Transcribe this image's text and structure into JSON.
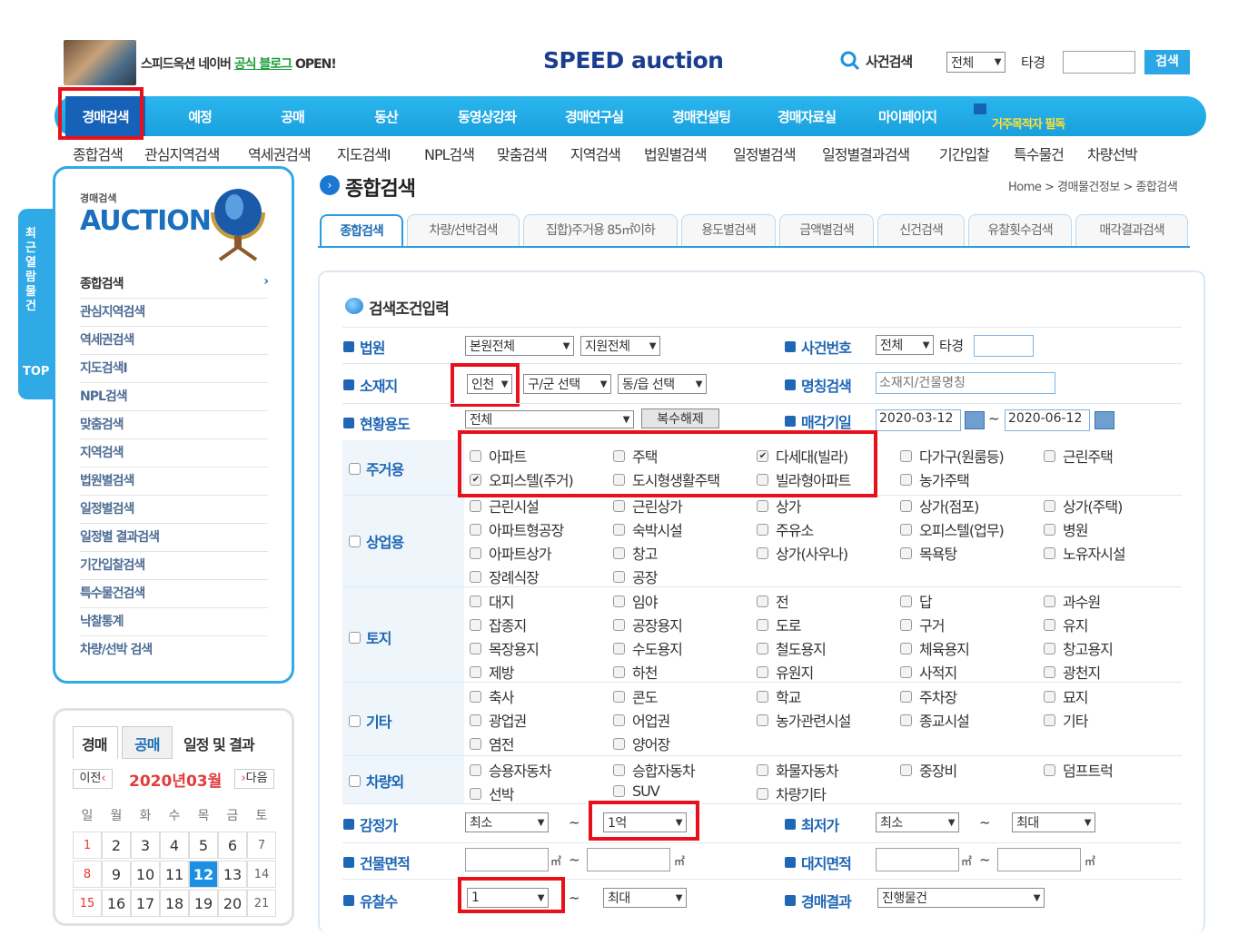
{
  "header": {
    "promo_prefix": "스피드옥션 네이버",
    "promo_highlight": "공식 블로그",
    "promo_suffix": "OPEN!",
    "brand_speed": "SPEED",
    "brand_auction": "auction",
    "case_search_label": "사건검색",
    "case_select": "전체",
    "case_word": "타경",
    "search_button": "검색"
  },
  "nav": [
    "경매검색",
    "예정",
    "공매",
    "동산",
    "동영상강좌",
    "경매연구실",
    "경매컨설팅",
    "경매자료실",
    "마이페이지"
  ],
  "nav_banner": "거주목적자 필독",
  "subnav": [
    "종합검색",
    "관심지역검색",
    "역세권검색",
    "지도검색Ⅰ",
    "NPL검색",
    "맞춤검색",
    "지역검색",
    "법원별검색",
    "일정별검색",
    "일정별결과검색",
    "기간입찰",
    "특수물건",
    "차량선박"
  ],
  "sidebar": {
    "tab_label": "최근열람물건",
    "top_label": "TOP",
    "small_title": "경매검색",
    "big_title": "AUCTION",
    "links": [
      "종합검색",
      "관심지역검색",
      "역세권검색",
      "지도검색Ⅰ",
      "NPL검색",
      "맞춤검색",
      "지역검색",
      "법원별검색",
      "일정별검색",
      "일정별 결과검색",
      "기간입찰검색",
      "특수물건검색",
      "낙찰통계",
      "차량/선박 검색"
    ]
  },
  "calendar": {
    "tabs": [
      "경매",
      "공매",
      "일정 및 결과"
    ],
    "prev": "이전",
    "month": "2020년03월",
    "next": "다음",
    "weekdays": [
      "일",
      "월",
      "화",
      "수",
      "목",
      "금",
      "토"
    ],
    "week1": [
      "1",
      "2",
      "3",
      "4",
      "5",
      "6",
      "7"
    ],
    "week2": [
      "8",
      "9",
      "10",
      "11",
      "12",
      "13",
      "14"
    ],
    "week3": [
      "15",
      "16",
      "17",
      "18",
      "19",
      "20",
      "21"
    ]
  },
  "main": {
    "title": "종합검색",
    "breadcrumb": "Home > 경매물건정보 > 종합검색",
    "tabs": [
      "종합검색",
      "차량/선박검색",
      "집합)주거용 85㎡이하",
      "용도별검색",
      "금액별검색",
      "신건검색",
      "유찰횟수검색",
      "매각결과검색"
    ],
    "panel_title": "검색조건입력"
  },
  "form": {
    "court_label": "법원",
    "court_value": "본원전체",
    "subcourt_value": "지원전체",
    "case_no_label": "사건번호",
    "case_no_select": "전체",
    "case_no_word": "타경",
    "location_label": "소재지",
    "location_city": "인천",
    "location_gu": "구/군 선택",
    "location_dong": "동/읍 선택",
    "name_search_label": "명칭검색",
    "name_search_placeholder": "소재지/건물명칭",
    "usage_label": "현황용도",
    "usage_value": "전체",
    "usage_reset": "복수해제",
    "sale_date_label": "매각기일",
    "sale_date_from": "2020-03-12",
    "sale_date_to": "2020-06-12",
    "tilde": "~",
    "residential_label": "주거용",
    "commercial_label": "상업용",
    "land_label": "토지",
    "etc_label": "기타",
    "vehicle_label": "차량외",
    "appraisal_label": "감정가",
    "appraisal_min": "최소",
    "appraisal_max": "1억",
    "lowest_label": "최저가",
    "lowest_min": "최소",
    "lowest_max": "최대",
    "building_area_label": "건물면적",
    "land_area_label": "대지면적",
    "unit": "㎡",
    "fail_count_label": "유찰수",
    "fail_min": "1",
    "fail_max": "최대",
    "result_label": "경매결과",
    "result_value": "진행물건"
  },
  "options": {
    "residential": [
      [
        "아파트",
        false
      ],
      [
        "주택",
        false
      ],
      [
        "다세대(빌라)",
        true
      ],
      [
        "다가구(원룸등)",
        false
      ],
      [
        "근린주택",
        false
      ],
      [
        "오피스텔(주거)",
        true
      ],
      [
        "도시형생활주택",
        false
      ],
      [
        "빌라형아파트",
        false
      ],
      [
        "농가주택",
        false
      ]
    ],
    "commercial": [
      [
        "근린시설",
        false
      ],
      [
        "근린상가",
        false
      ],
      [
        "상가",
        false
      ],
      [
        "상가(점포)",
        false
      ],
      [
        "상가(주택)",
        false
      ],
      [
        "아파트형공장",
        false
      ],
      [
        "숙박시설",
        false
      ],
      [
        "주유소",
        false
      ],
      [
        "오피스텔(업무)",
        false
      ],
      [
        "병원",
        false
      ],
      [
        "아파트상가",
        false
      ],
      [
        "창고",
        false
      ],
      [
        "상가(사우나)",
        false
      ],
      [
        "목욕탕",
        false
      ],
      [
        "노유자시설",
        false
      ],
      [
        "장례식장",
        false
      ],
      [
        "공장",
        false
      ]
    ],
    "land": [
      [
        "대지",
        false
      ],
      [
        "임야",
        false
      ],
      [
        "전",
        false
      ],
      [
        "답",
        false
      ],
      [
        "과수원",
        false
      ],
      [
        "잡종지",
        false
      ],
      [
        "공장용지",
        false
      ],
      [
        "도로",
        false
      ],
      [
        "구거",
        false
      ],
      [
        "유지",
        false
      ],
      [
        "목장용지",
        false
      ],
      [
        "수도용지",
        false
      ],
      [
        "철도용지",
        false
      ],
      [
        "체육용지",
        false
      ],
      [
        "창고용지",
        false
      ],
      [
        "제방",
        false
      ],
      [
        "하천",
        false
      ],
      [
        "유원지",
        false
      ],
      [
        "사적지",
        false
      ],
      [
        "광천지",
        false
      ]
    ],
    "etc": [
      [
        "축사",
        false
      ],
      [
        "콘도",
        false
      ],
      [
        "학교",
        false
      ],
      [
        "주차장",
        false
      ],
      [
        "묘지",
        false
      ],
      [
        "광업권",
        false
      ],
      [
        "어업권",
        false
      ],
      [
        "농가관련시설",
        false
      ],
      [
        "종교시설",
        false
      ],
      [
        "기타",
        false
      ],
      [
        "염전",
        false
      ],
      [
        "양어장",
        false
      ]
    ],
    "vehicle": [
      [
        "승용자동차",
        false
      ],
      [
        "승합자동차",
        false
      ],
      [
        "화물자동차",
        false
      ],
      [
        "중장비",
        false
      ],
      [
        "덤프트럭",
        false
      ],
      [
        "선박",
        false
      ],
      [
        "SUV",
        false
      ],
      [
        "차량기타",
        false
      ]
    ]
  },
  "colors": {
    "accent": "#1f66b5",
    "nav": "#1aa0dd",
    "highlight_box": "#e8101a"
  }
}
